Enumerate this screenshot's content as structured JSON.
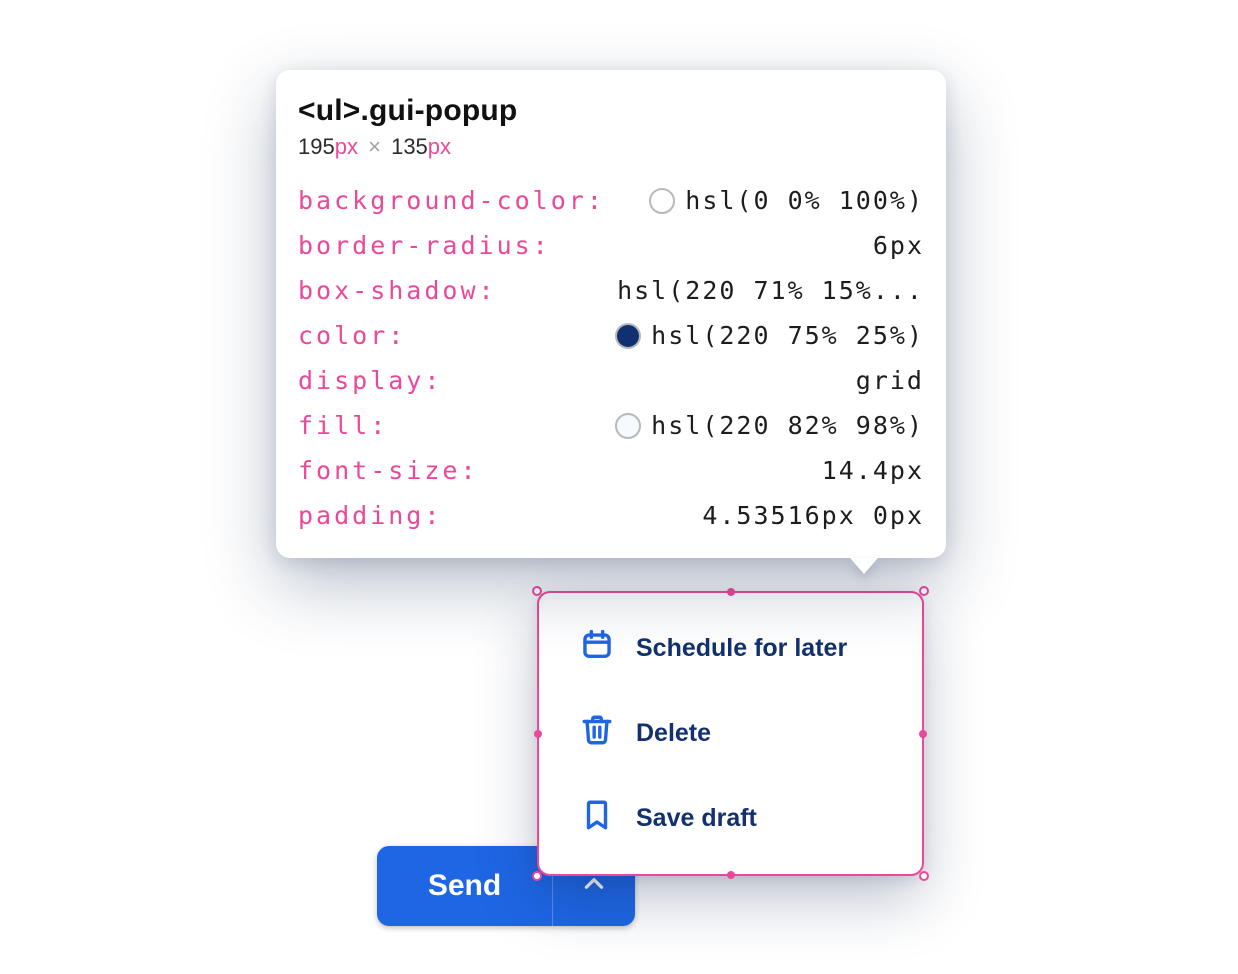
{
  "tooltip": {
    "selector_tag": "<ul>",
    "selector_class": ".gui-popup",
    "width_num": "195",
    "height_num": "135",
    "px_unit": "px",
    "times": "×",
    "props": [
      {
        "name": "background-color",
        "value": "hsl(0 0% 100%)",
        "swatch": "#ffffff"
      },
      {
        "name": "border-radius",
        "value": "6px",
        "swatch": null
      },
      {
        "name": "box-shadow",
        "value": "hsl(220 71% 15%...",
        "swatch": null
      },
      {
        "name": "color",
        "value": "hsl(220 75% 25%)",
        "swatch": "#10306f"
      },
      {
        "name": "display",
        "value": "grid",
        "swatch": null
      },
      {
        "name": "fill",
        "value": "hsl(220 82% 98%)",
        "swatch": "#f6f9fe"
      },
      {
        "name": "font-size",
        "value": "14.4px",
        "swatch": null
      },
      {
        "name": "padding",
        "value": "4.53516px 0px",
        "swatch": null
      }
    ]
  },
  "popup": {
    "items": [
      {
        "icon": "calendar-icon",
        "label": "Schedule for later"
      },
      {
        "icon": "trash-icon",
        "label": "Delete"
      },
      {
        "icon": "bookmark-icon",
        "label": "Save draft"
      }
    ]
  },
  "send": {
    "label": "Send"
  }
}
